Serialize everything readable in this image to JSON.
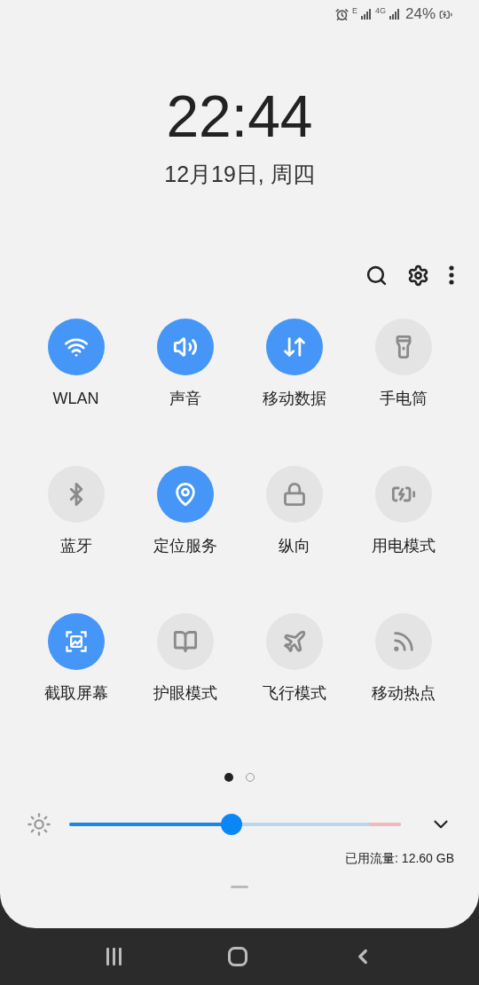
{
  "status_bar": {
    "network_1": "E",
    "network_2": "4G",
    "battery": "24%"
  },
  "clock": {
    "time": "22:44",
    "date": "12月19日, 周四"
  },
  "tiles": [
    {
      "kind": "wifi",
      "label": "WLAN",
      "on": true
    },
    {
      "kind": "sound",
      "label": "声音",
      "on": true
    },
    {
      "kind": "data",
      "label": "移动数据",
      "on": true
    },
    {
      "kind": "flashlight",
      "label": "手电筒",
      "on": false
    },
    {
      "kind": "bluetooth",
      "label": "蓝牙",
      "on": false
    },
    {
      "kind": "location",
      "label": "定位服务",
      "on": true
    },
    {
      "kind": "rotation",
      "label": "纵向",
      "on": false
    },
    {
      "kind": "power",
      "label": "用电模式",
      "on": false
    },
    {
      "kind": "screenshot",
      "label": "截取屏幕",
      "on": true
    },
    {
      "kind": "eyecare",
      "label": "护眼模式",
      "on": false
    },
    {
      "kind": "airplane",
      "label": "飞行模式",
      "on": false
    },
    {
      "kind": "hotspot",
      "label": "移动热点",
      "on": false
    }
  ],
  "pages": [
    {
      "selected": true
    },
    {
      "selected": false
    }
  ],
  "brightness": {
    "level": 0.49
  },
  "data_usage": "已用流量: 12.60 GB"
}
